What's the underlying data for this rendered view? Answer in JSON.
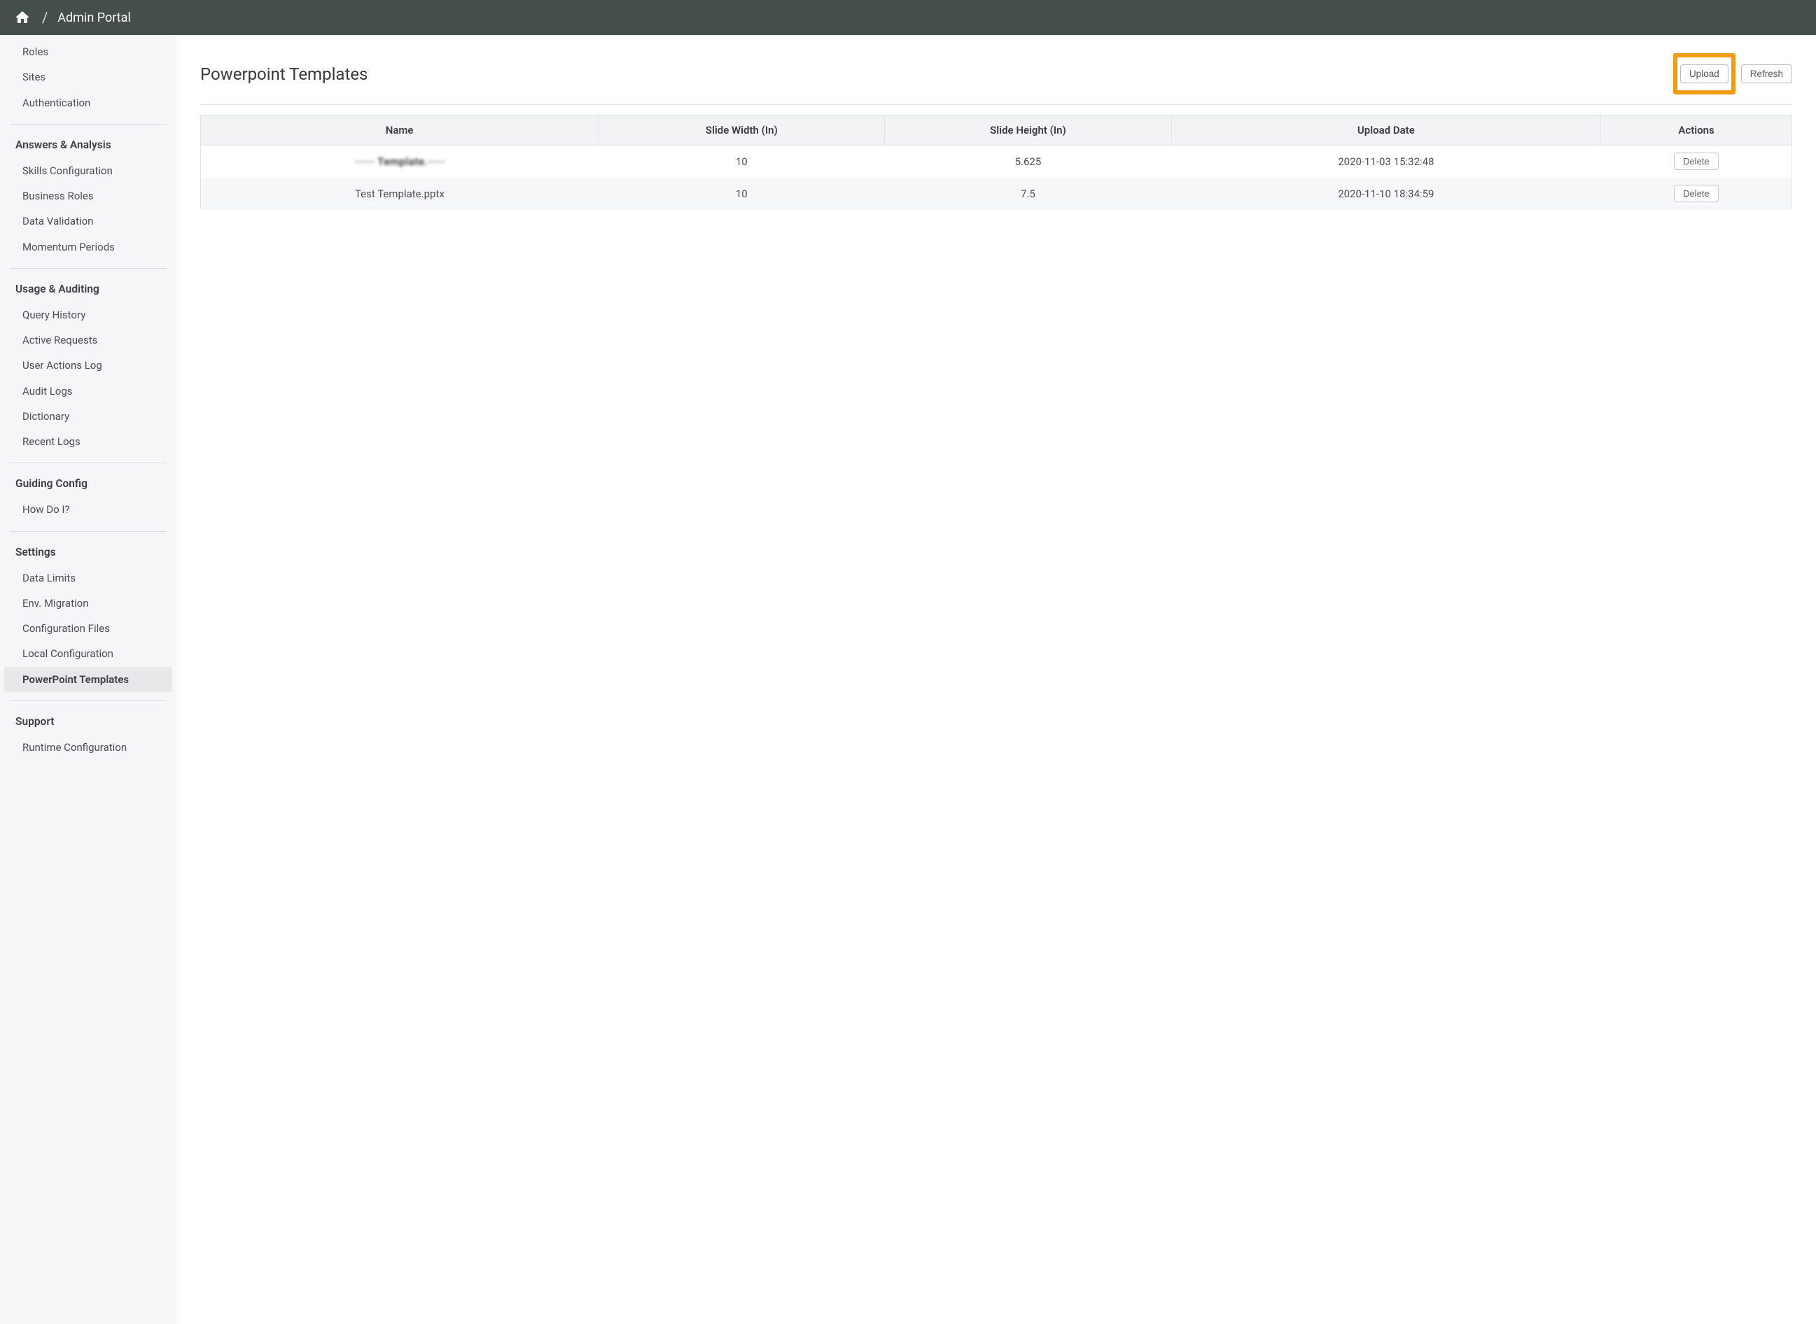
{
  "breadcrumb": {
    "title": "Admin Portal",
    "separator": "/"
  },
  "sidebar": {
    "top_items": [
      "Roles",
      "Sites",
      "Authentication"
    ],
    "sections": [
      {
        "title": "Answers & Analysis",
        "items": [
          "Skills Configuration",
          "Business Roles",
          "Data Validation",
          "Momentum Periods"
        ]
      },
      {
        "title": "Usage & Auditing",
        "items": [
          "Query History",
          "Active Requests",
          "User Actions Log",
          "Audit Logs",
          "Dictionary",
          "Recent Logs"
        ]
      },
      {
        "title": "Guiding Config",
        "items": [
          "How Do I?"
        ]
      },
      {
        "title": "Settings",
        "items": [
          "Data Limits",
          "Env. Migration",
          "Configuration Files",
          "Local Configuration",
          "PowerPoint Templates"
        ],
        "active_index": 4
      },
      {
        "title": "Support",
        "items": [
          "Runtime Configuration"
        ]
      }
    ]
  },
  "page": {
    "title": "Powerpoint Templates",
    "upload_label": "Upload",
    "refresh_label": "Refresh"
  },
  "table": {
    "headers": {
      "name": "Name",
      "width": "Slide Width (In)",
      "height": "Slide Height (In)",
      "upload_date": "Upload Date",
      "actions": "Actions"
    },
    "delete_label": "Delete",
    "rows": [
      {
        "name": "······ Template.·····",
        "blurred": true,
        "width": "10",
        "height": "5.625",
        "upload_date": "2020-11-03 15:32:48"
      },
      {
        "name": "Test Template.pptx",
        "blurred": false,
        "width": "10",
        "height": "7.5",
        "upload_date": "2020-11-10 18:34:59"
      }
    ]
  }
}
